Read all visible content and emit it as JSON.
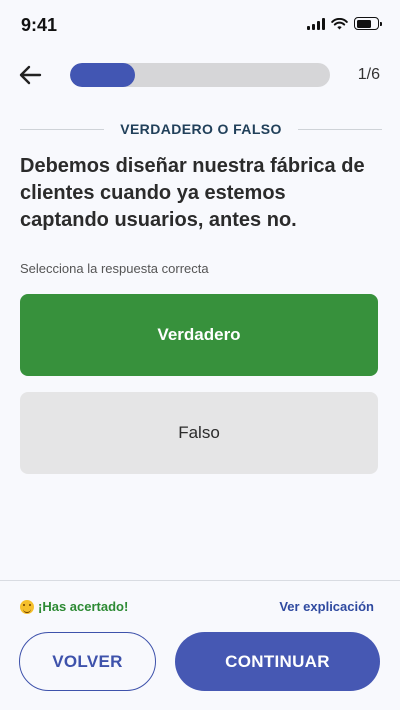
{
  "status_bar": {
    "time": "9:41"
  },
  "header": {
    "progress_text": "1/6",
    "progress_fraction": 0.25
  },
  "section": {
    "title": "VERDADERO O FALSO"
  },
  "question": {
    "text": "Debemos diseñar nuestra fábrica de clientes cuando ya estemos captando usuarios, antes no.",
    "instruction": "Selecciona la respuesta correcta"
  },
  "options": [
    {
      "label": "Verdadero",
      "state": "correct-selected"
    },
    {
      "label": "Falso",
      "state": "unselected"
    }
  ],
  "feedback": {
    "message": "¡Has acertado!",
    "emoji_icon": "party-face-emoji",
    "explain_link": "Ver explicación"
  },
  "actions": {
    "back_label": "VOLVER",
    "continue_label": "CONTINUAR"
  },
  "colors": {
    "primary": "#4658b3",
    "correct": "#37913c",
    "option_neutral": "#e5e5e6",
    "background": "#f8f9fd"
  }
}
